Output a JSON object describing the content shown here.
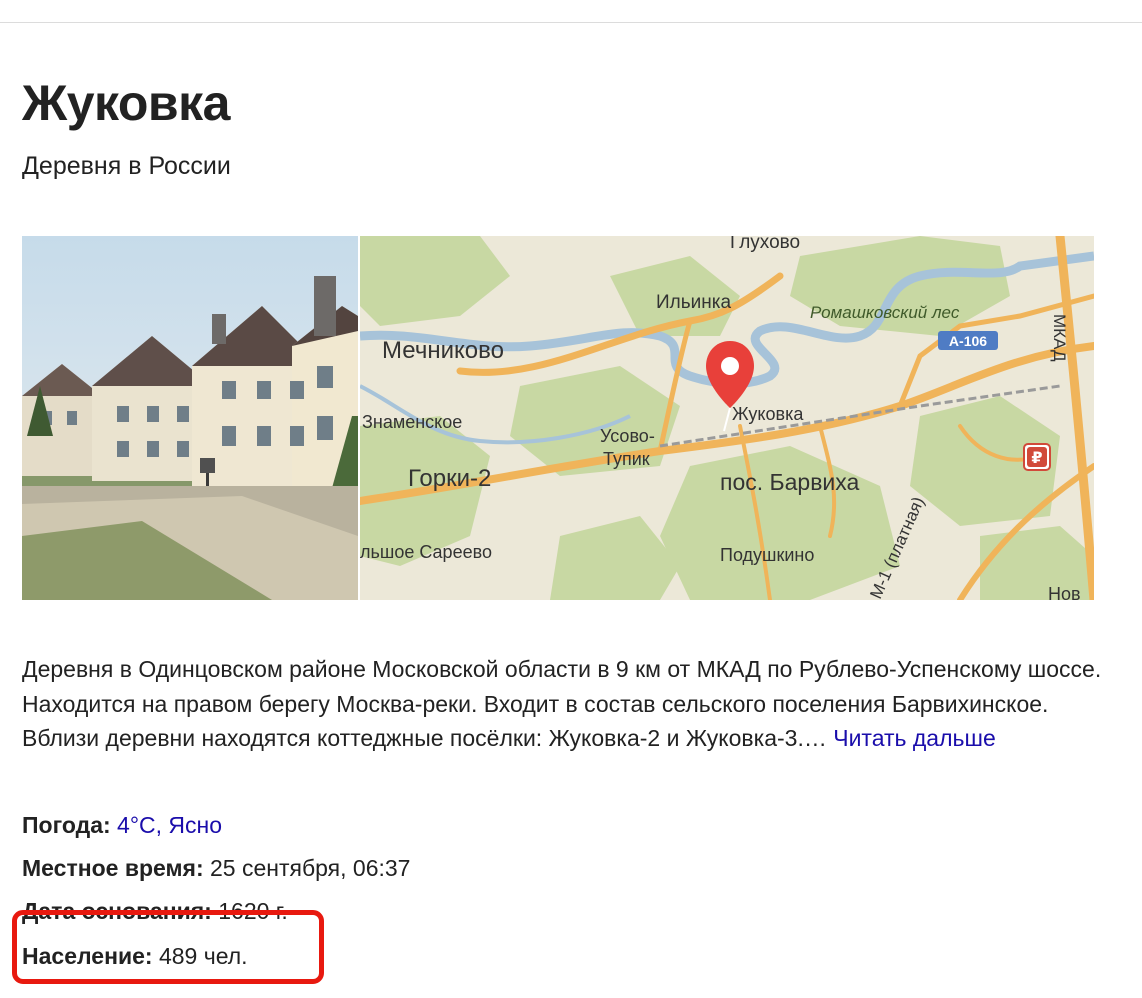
{
  "header": {
    "title": "Жуковка",
    "subtitle": "Деревня в России"
  },
  "map": {
    "labels": {
      "gluhovo": "Глухово",
      "ilinka": "Ильинка",
      "romashkovsky": "Ромашковский лес",
      "mechnikovo": "Мечниково",
      "a106": "А-106",
      "mkad": "МКАД",
      "znamenskoe": "Знаменское",
      "zhukovka": "Жуковка",
      "usovo": "Усово-",
      "tupik": "Тупик",
      "gorki2": "Горки-2",
      "barviha": "пос. Барвиха",
      "saree": "льшое Сареево",
      "podushkino": "Подушкино",
      "m1": "М-1 (платная)",
      "nov": "Нов",
      "ruble": "₽"
    },
    "colors": {
      "road": "#f0b45a",
      "river": "#a7c3d9",
      "forest": "#c8d8a3",
      "land": "#ece8d8",
      "pin": "#e8403a"
    }
  },
  "description": {
    "text": "Деревня в Одинцовском районе Московской области в 9 км от МКАД по Рублево-Успенскому шоссе. Находится на правом берегу Москва-реки. Входит в состав сельского поселения Барвихинское. Вблизи деревни находятся коттеджные посёлки: Жуковка-2 и Жуковка-3.…",
    "more_link": "Читать дальше"
  },
  "facts": {
    "weather_label": "Погода:",
    "weather_value": "4°C, Ясно",
    "time_label": "Местное время:",
    "time_value": "25 сентября, 06:37",
    "founded_label": "Дата основания:",
    "founded_value": "1620 г.",
    "population_label": "Население:",
    "population_value": "489 чел."
  }
}
